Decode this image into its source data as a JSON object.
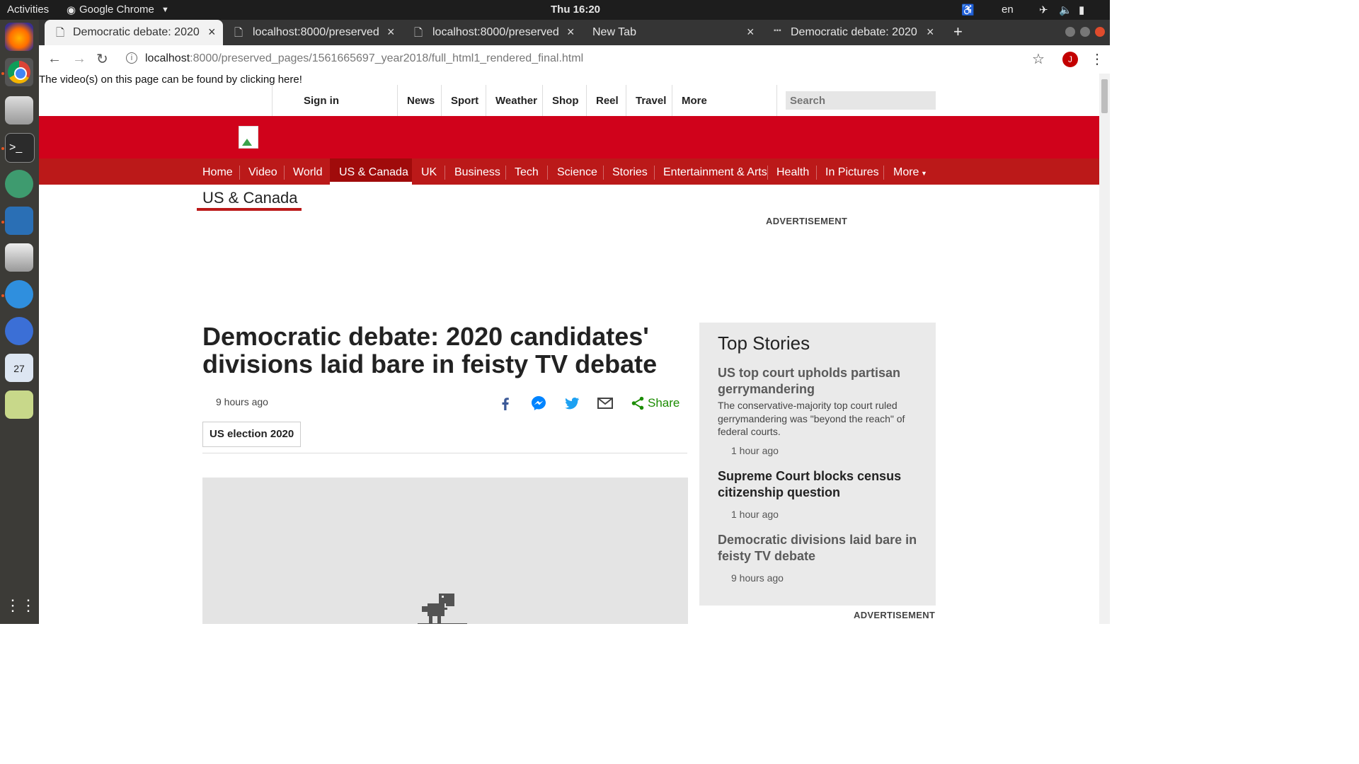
{
  "os": {
    "activities": "Activities",
    "app_name": "Google Chrome",
    "clock": "Thu 16:20",
    "lang": "en"
  },
  "browser": {
    "tabs": [
      {
        "title": "Democratic debate: 2020",
        "active": true
      },
      {
        "title": "localhost:8000/preserved",
        "active": false
      },
      {
        "title": "localhost:8000/preserved",
        "active": false
      },
      {
        "title": "New Tab",
        "active": false
      },
      {
        "title": "Democratic debate: 2020",
        "active": false
      }
    ],
    "url_host": "localhost",
    "url_rest": ":8000/preserved_pages/1561665697_year2018/full_html1_rendered_final.html",
    "profile_initial": "J"
  },
  "page": {
    "video_notice": "The video(s) on this page can be found by clicking here!",
    "top_nav": {
      "sign_in": "Sign in",
      "items": [
        "News",
        "Sport",
        "Weather",
        "Shop",
        "Reel",
        "Travel",
        "More"
      ],
      "search_placeholder": "Search"
    },
    "section_nav": {
      "items": [
        "Home",
        "Video",
        "World",
        "US & Canada",
        "UK",
        "Business",
        "Tech",
        "Science",
        "Stories",
        "Entertainment & Arts",
        "Health",
        "In Pictures",
        "More"
      ],
      "active": "US & Canada"
    },
    "section_title": "US & Canada",
    "advertisement_label": "ADVERTISEMENT",
    "article": {
      "headline": "Democratic debate: 2020 candidates' divisions laid bare in feisty TV debate",
      "timestamp": "9 hours ago",
      "share_label": "Share",
      "tag": "US election 2020"
    },
    "top_stories": {
      "heading": "Top Stories",
      "items": [
        {
          "title": "US top court upholds partisan gerrymandering",
          "summary": "The conservative-majority top court ruled gerrymandering was \"beyond the reach\" of federal courts.",
          "time": "1 hour ago"
        },
        {
          "title": "Supreme Court blocks census citizenship question",
          "summary": "",
          "time": "1 hour ago"
        },
        {
          "title": "Democratic divisions laid bare in feisty TV debate",
          "summary": "",
          "time": "9 hours ago"
        }
      ]
    },
    "advertisement_label_2": "ADVERTISEMENT"
  },
  "colors": {
    "bbc_red": "#bb1919",
    "link_grey": "#5a5a5a",
    "share_green": "#1b8c00"
  }
}
